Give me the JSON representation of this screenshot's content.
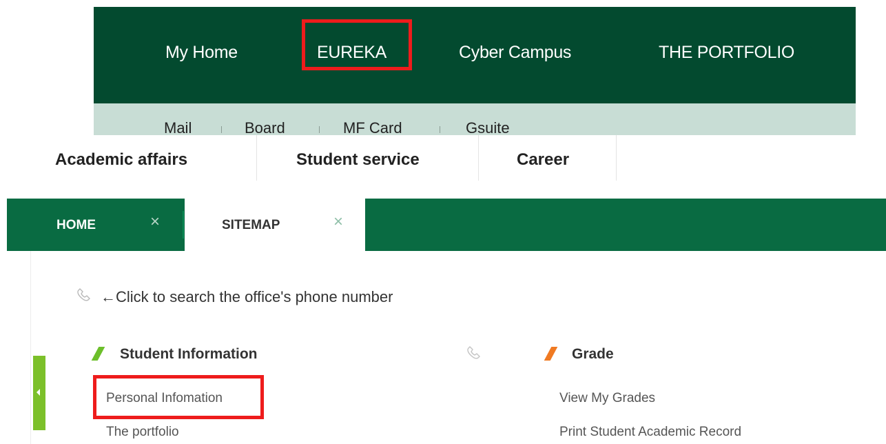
{
  "portal_nav": {
    "items": [
      "My Home",
      "EUREKA",
      "Cyber Campus",
      "THE PORTFOLIO"
    ]
  },
  "sub_nav": {
    "items": [
      "Mail",
      "Board",
      "MF Card",
      "Gsuite"
    ]
  },
  "menu": {
    "items": [
      "Academic affairs",
      "Student service",
      "Career"
    ]
  },
  "tabs": [
    {
      "label": "HOME",
      "close": "×"
    },
    {
      "label": "SITEMAP",
      "close": "×"
    }
  ],
  "content": {
    "hint": "←Click to search the office's phone number",
    "sections": [
      {
        "title": "Student Information",
        "links": [
          "Personal Infomation",
          "The portfolio"
        ]
      },
      {
        "title": "Grade",
        "links": [
          "View My Grades",
          "Print Student Academic Record"
        ]
      }
    ]
  },
  "colors": {
    "portal_bg": "#034a2f",
    "subnav_bg": "#c8ddd5",
    "tabbar_bg": "#096b42",
    "mark_green": "#6cbf2a",
    "mark_orange": "#f07a22",
    "highlight_red": "#ee1c1c"
  },
  "icons": {
    "phone": "phone-icon"
  }
}
